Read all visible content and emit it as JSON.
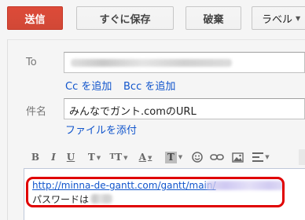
{
  "toolbar": {
    "send_label": "送信",
    "save_label": "すぐに保存",
    "discard_label": "破棄",
    "label_label": "ラベル"
  },
  "compose": {
    "to_label": "To",
    "cc_label": "Cc を追加",
    "bcc_label": "Bcc を追加",
    "subject_label": "件名",
    "subject_value": "みんなでガント.comのURL",
    "attach_label": "ファイルを添付"
  },
  "format_bar": {
    "icons": [
      "bold-icon",
      "italic-icon",
      "underline-icon",
      "font-family-icon",
      "font-size-icon",
      "text-color-icon",
      "highlight-color-icon",
      "emoji-icon",
      "link-icon",
      "image-icon",
      "align-icon"
    ]
  },
  "editor": {
    "link_text": "http://minna-de-gantt.com/gantt/main/",
    "password_label": "パスワードは"
  },
  "colors": {
    "send_button": "#d14836",
    "link": "#1155cc",
    "highlight_border": "#e00000"
  }
}
